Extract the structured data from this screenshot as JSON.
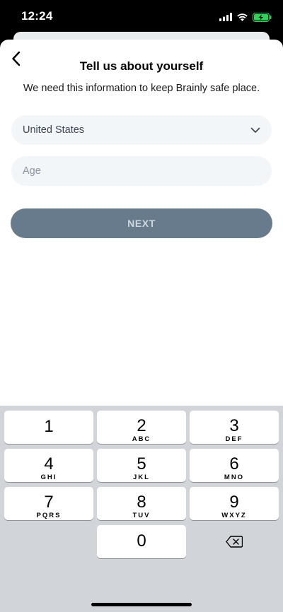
{
  "status": {
    "time": "12:24"
  },
  "header": {
    "title": "Tell us about yourself",
    "subtitle": "We need this information to keep Brainly safe place."
  },
  "form": {
    "country_value": "United States",
    "age_placeholder": "Age",
    "next_label": "NEXT"
  },
  "keypad": {
    "keys": [
      {
        "num": "1",
        "letters": ""
      },
      {
        "num": "2",
        "letters": "ABC"
      },
      {
        "num": "3",
        "letters": "DEF"
      },
      {
        "num": "4",
        "letters": "GHI"
      },
      {
        "num": "5",
        "letters": "JKL"
      },
      {
        "num": "6",
        "letters": "MNO"
      },
      {
        "num": "7",
        "letters": "PQRS"
      },
      {
        "num": "8",
        "letters": "TUV"
      },
      {
        "num": "9",
        "letters": "WXYZ"
      },
      {
        "num": "0",
        "letters": ""
      }
    ]
  },
  "colors": {
    "next_button_bg": "#687b8c",
    "field_bg": "#f2f6f9",
    "keyboard_bg": "#d1d4d9",
    "battery_green": "#30d158"
  },
  "icons": {
    "back": "chevron-left-icon",
    "dropdown": "chevron-down-icon",
    "delete": "backspace-icon",
    "signal": "cellular-signal-icon",
    "wifi": "wifi-icon",
    "battery": "battery-charging-icon"
  }
}
